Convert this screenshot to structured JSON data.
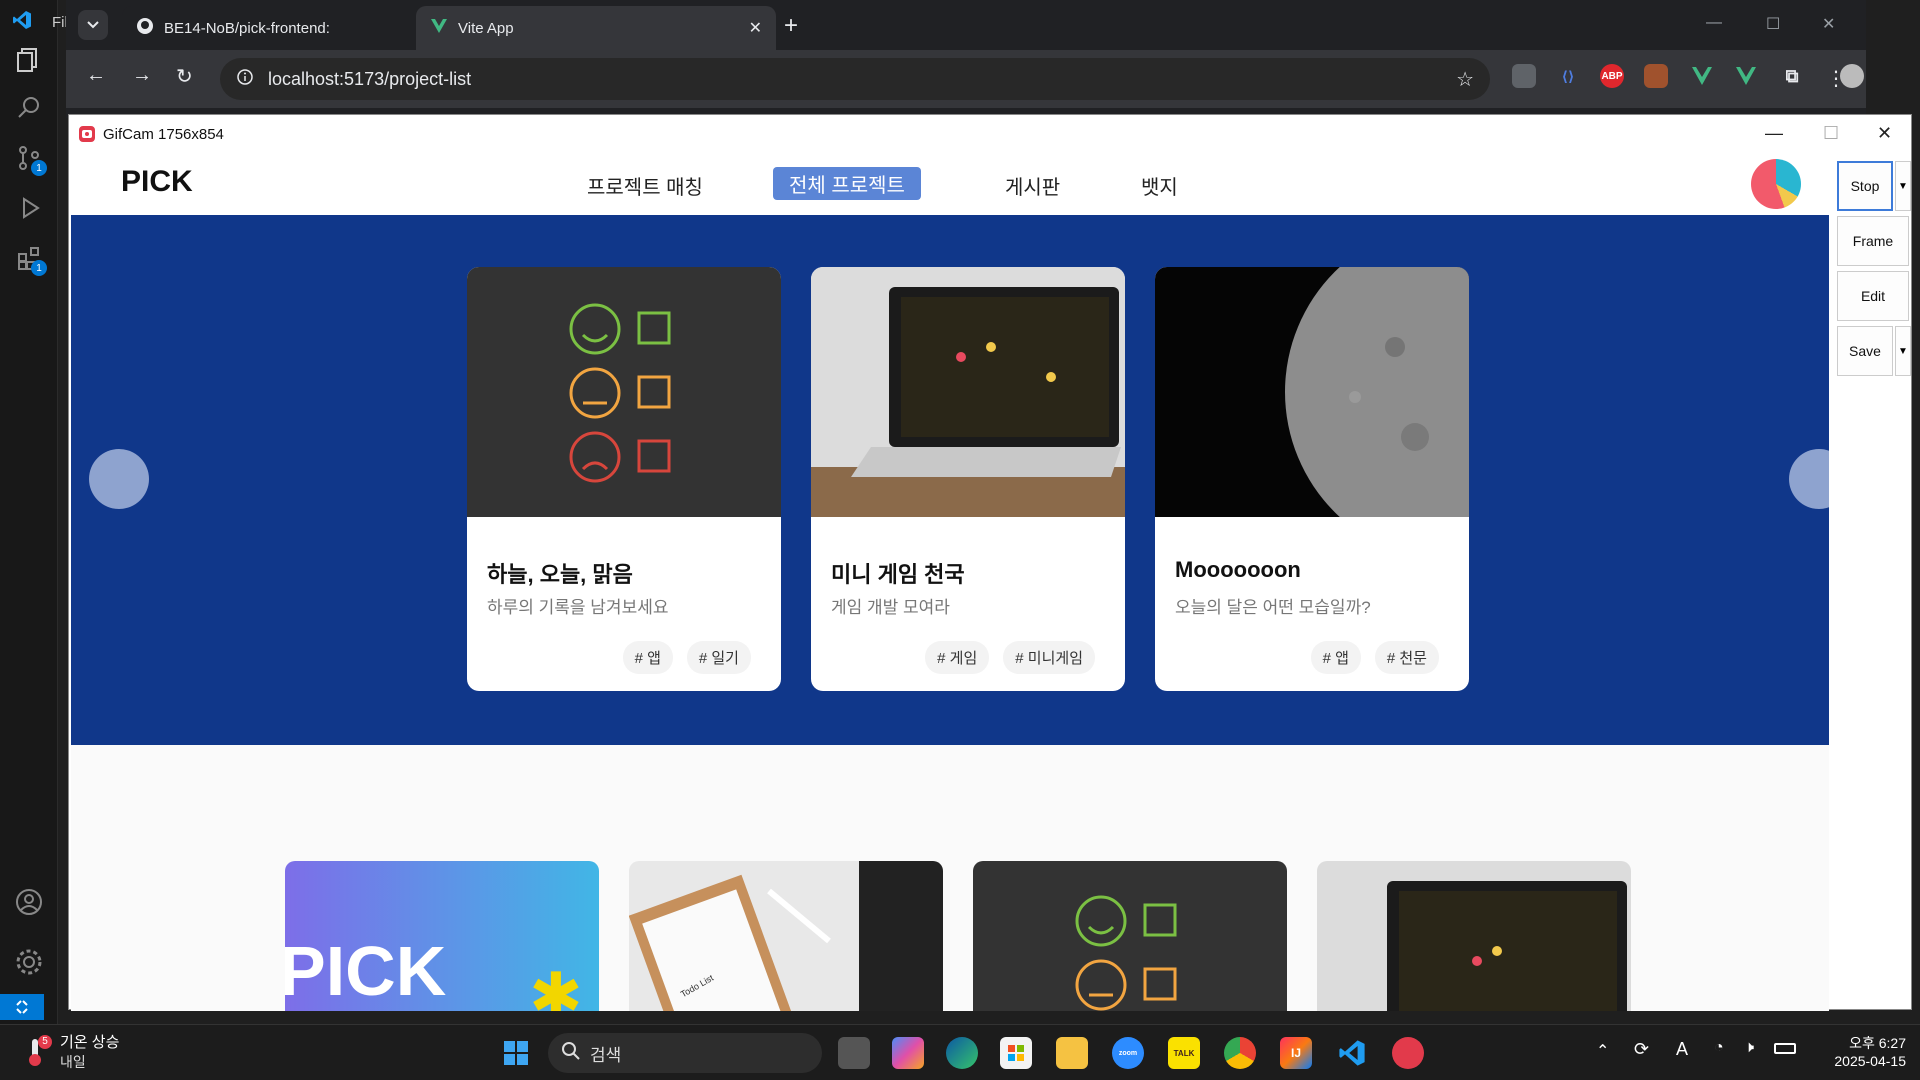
{
  "vscode": {
    "menu_label": "Fil",
    "badges": {
      "source_control": "1",
      "extensions": "1"
    }
  },
  "browser": {
    "tabs": [
      {
        "title": "BE14-NoB/pick-frontend:",
        "icon": "github-icon"
      },
      {
        "title": "Vite App",
        "icon": "vite-icon"
      }
    ],
    "url": "localhost:5173/project-list",
    "extensions": [
      {
        "name": "globe-icon",
        "color": "#9aa0a6",
        "label": ""
      },
      {
        "name": "translate-icon",
        "color": "#4f7ddf",
        "label": ""
      },
      {
        "name": "adblock-icon",
        "color": "#e0272d",
        "label": "ABP"
      },
      {
        "name": "briefcase-icon",
        "color": "#a0522d",
        "label": ""
      },
      {
        "name": "vue-icon",
        "color": "#41b883",
        "label": ""
      },
      {
        "name": "vue-icon",
        "color": "#41b883",
        "label": ""
      },
      {
        "name": "puzzle-icon",
        "color": "#9aa0a6",
        "label": ""
      }
    ]
  },
  "gifcam": {
    "title": "GifCam 1756x854",
    "buttons": {
      "stop": "Stop",
      "frame": "Frame",
      "edit": "Edit",
      "save": "Save"
    }
  },
  "site": {
    "logo": "PICK",
    "nav": [
      "프로젝트 매칭",
      "전체 프로젝트",
      "게시판",
      "뱃지"
    ],
    "active_nav": "전체 프로젝트",
    "featured": [
      {
        "title": "하늘, 오늘, 맑음",
        "desc": "하루의 기록을 남겨보세요",
        "tags": [
          "# 앱",
          "# 일기"
        ],
        "image": "chalkboard-emotions"
      },
      {
        "title": "미니 게임 천국",
        "desc": "게임 개발 모여라",
        "tags": [
          "# 게임",
          "# 미니게임"
        ],
        "image": "laptop-pacman"
      },
      {
        "title": "Mooooooon",
        "desc": "오늘의 달은 어떤 모습일까?",
        "tags": [
          "# 앱",
          "# 천문"
        ],
        "image": "moon"
      }
    ],
    "grid": [
      {
        "image": "pick-banner",
        "text": "PICK"
      },
      {
        "image": "clipboard-todo",
        "text": "Todo List"
      },
      {
        "image": "chalkboard-emotions",
        "text": ""
      },
      {
        "image": "laptop-pacman",
        "text": ""
      }
    ]
  },
  "taskbar": {
    "weather": {
      "line1": "기온 상승",
      "line2": "내일",
      "badge": "5"
    },
    "search_placeholder": "검색",
    "clock": {
      "time": "오후 6:27",
      "date": "2025-04-15"
    },
    "apps": [
      "windows-start-icon",
      "search-icon",
      "task-view-icon",
      "copilot-icon",
      "edge-icon",
      "store-icon",
      "file-explorer-icon",
      "zoom-icon",
      "kakaotalk-icon",
      "chrome-icon",
      "intellij-icon",
      "vscode-icon",
      "gifcam-icon"
    ]
  }
}
